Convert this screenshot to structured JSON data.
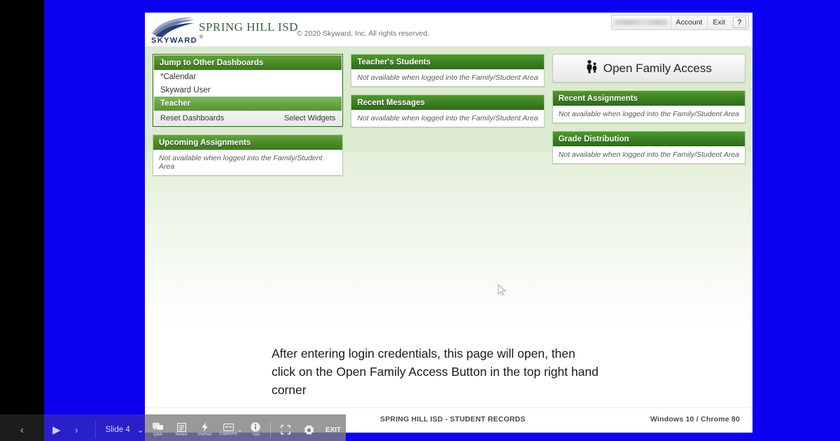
{
  "player": {
    "prev_label": "‹",
    "play_label": "▶",
    "next_label": "›",
    "slide_label": "Slide 4",
    "slide_caret": "⌄",
    "tools": [
      {
        "icon": "qa-icon",
        "label": "Q&A"
      },
      {
        "icon": "notes-icon",
        "label": "Notes"
      },
      {
        "icon": "pointer-icon",
        "label": "Polmer"
      },
      {
        "icon": "captions-icon",
        "label": "Captions"
      },
      {
        "icon": "tips-icon",
        "label": "Tips"
      }
    ],
    "captions_caret": "⌄",
    "fullscreen_icon": "fullscreen-icon",
    "settings_icon": "gear-icon",
    "exit_label": "EXIT"
  },
  "app": {
    "logo_alt": "SKYWARD",
    "logo_wordmark": "SKYWARD",
    "district": "SPRING HILL ISD",
    "header_user_masked": "",
    "account_label": "Account",
    "exit_label": "Exit",
    "help_label": "?"
  },
  "dashboards_widget": {
    "title": "Jump to Other Dashboards",
    "items": [
      {
        "label": "*Calendar",
        "selected": false
      },
      {
        "label": "Skyward User",
        "selected": false
      },
      {
        "label": "Teacher",
        "selected": true
      }
    ],
    "reset_label": "Reset Dashboards",
    "select_widgets_label": "Select Widgets"
  },
  "widgets": {
    "unavailable_text": "Not available when logged into the Family/Student Area",
    "upcoming_assignments": "Upcoming Assignments",
    "teachers_students": "Teacher's Students",
    "recent_messages": "Recent Messages",
    "recent_assignments": "Recent Assignments",
    "grade_distribution": "Grade Distribution"
  },
  "family_access": {
    "label": "Open Family Access",
    "icon": "family-people-icon"
  },
  "caption": {
    "text": "After entering login credentials, this page will open, then click on the Open Family Access Button in the top right hand corner"
  },
  "slide_footer": {
    "copyright": "© 2020 Skyward, Inc. All rights reserved.",
    "center": "SPRING HILL ISD - STUDENT RECORDS",
    "right": "Windows 10 / Chrome 80"
  },
  "colors": {
    "backdrop_blue": "#0c00f0",
    "body_green": "#dcebd0",
    "widget_green": "#4d8c2b",
    "selected_green": "#69a647",
    "toolbar_blue": "#2a20c8"
  }
}
